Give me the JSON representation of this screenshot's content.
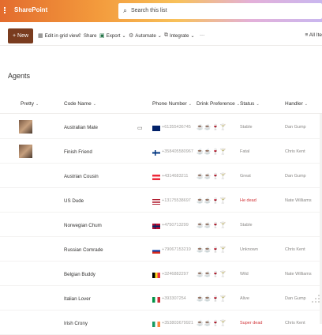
{
  "app": {
    "brand": "SharePoint",
    "search_placeholder": "Search this list"
  },
  "toolbar": {
    "new_label": "New",
    "items": [
      {
        "label": "Edit in grid view",
        "icon": "grid-edit-icon"
      },
      {
        "label": "Share",
        "icon": "share-icon"
      },
      {
        "label": "Export",
        "icon": "excel-icon"
      },
      {
        "label": "Automate",
        "icon": "automate-icon"
      },
      {
        "label": "Integrate",
        "icon": "integrate-icon"
      },
      {
        "label": "···",
        "icon": "more-icon"
      }
    ],
    "view_label": "All Ite"
  },
  "page": {
    "title": "Agents"
  },
  "columns": [
    "Pretty",
    "Code Name",
    "Phone Number",
    "Drink Preference",
    "Status",
    "Handler"
  ],
  "rows": [
    {
      "code_name": "Australian Mate",
      "phone": "+61355436745",
      "status": "Stable",
      "handler": "Dan Gump",
      "has_pic": true,
      "has_comment": true,
      "flag": "au",
      "drinks_active": [
        0,
        1
      ]
    },
    {
      "code_name": "Finish Friend",
      "phone": "+358405580967",
      "status": "Fatal",
      "handler": "Chris Kent",
      "has_pic": true,
      "flag": "fi",
      "drinks_active": [
        2,
        3
      ]
    },
    {
      "code_name": "Austrian Cousin",
      "phone": "+4314683211",
      "status": "Great",
      "handler": "Dan Gump",
      "flag": "at",
      "drinks_active": [
        2
      ]
    },
    {
      "code_name": "US Dude",
      "phone": "+13175538697",
      "status": "He dead",
      "status_red": true,
      "handler": "Nate Williams",
      "flag": "us",
      "drinks_active": []
    },
    {
      "code_name": "Norwegian Chum",
      "phone": "+4750713299",
      "status": "Stable",
      "handler": "",
      "flag": "no",
      "drinks_active": [
        0
      ]
    },
    {
      "code_name": "Russian Comrade",
      "phone": "+79067153219",
      "status": "Unknown",
      "handler": "Chris Kent",
      "flag": "ru",
      "drinks_active": []
    },
    {
      "code_name": "Belgian Buddy",
      "phone": "+3246882297",
      "status": "Wild",
      "handler": "Nate Williams",
      "flag": "be",
      "drinks_active": []
    },
    {
      "code_name": "Italian Lover",
      "phone": "+393307254",
      "status": "Alive",
      "handler": "Dan Gump",
      "flag": "it",
      "drinks_active": []
    },
    {
      "code_name": "Irish Crony",
      "phone": "+353803679921",
      "status": "Super dead",
      "status_red": true,
      "handler": "Chris Kent",
      "flag": "ie",
      "drinks_active": []
    }
  ],
  "drink_icons": [
    "☕",
    "☕",
    "🍷",
    "🍸"
  ]
}
